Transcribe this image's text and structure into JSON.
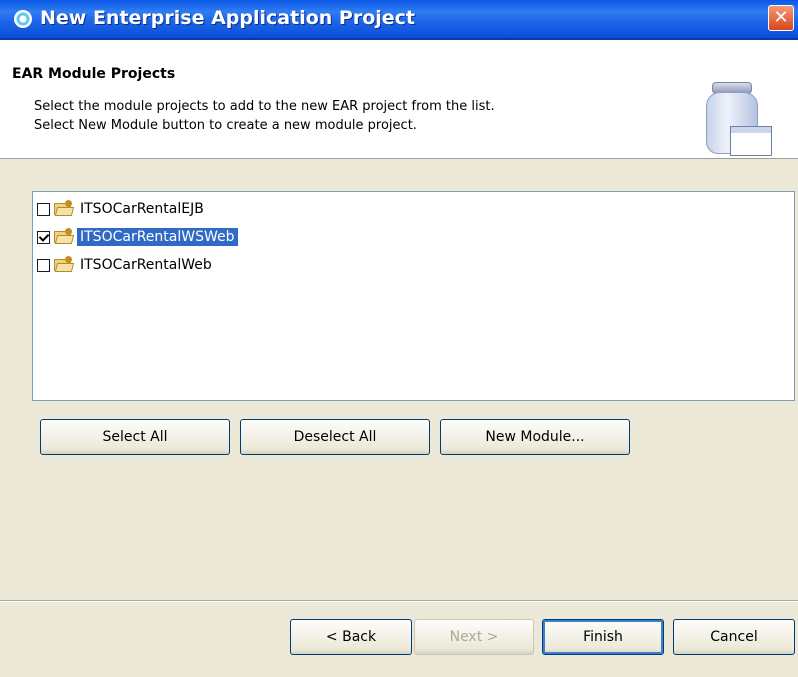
{
  "window": {
    "title": "New Enterprise Application Project",
    "close_glyph": "✕"
  },
  "header": {
    "title": "EAR Module Projects",
    "description_line1": "Select the module projects to add to the new EAR project from the list.",
    "description_line2": "Select New Module button to create a new module project.",
    "banner_icon": "jar-window-icon"
  },
  "module_list": {
    "items": [
      {
        "label": "ITSOCarRentalEJB",
        "checked": false,
        "selected": false,
        "icon": "project-folder-icon"
      },
      {
        "label": "ITSOCarRentalWSWeb",
        "checked": true,
        "selected": true,
        "icon": "project-folder-icon"
      },
      {
        "label": "ITSOCarRentalWeb",
        "checked": false,
        "selected": false,
        "icon": "project-folder-icon"
      }
    ]
  },
  "list_buttons": {
    "select_all": "Select All",
    "deselect_all": "Deselect All",
    "new_module": "New Module..."
  },
  "wizard_buttons": {
    "back": "< Back",
    "next": "Next >",
    "finish": "Finish",
    "cancel": "Cancel"
  },
  "colors": {
    "titlebar": "#0a58e6",
    "selection": "#316ac5",
    "dialog_bg": "#ece9d8"
  }
}
